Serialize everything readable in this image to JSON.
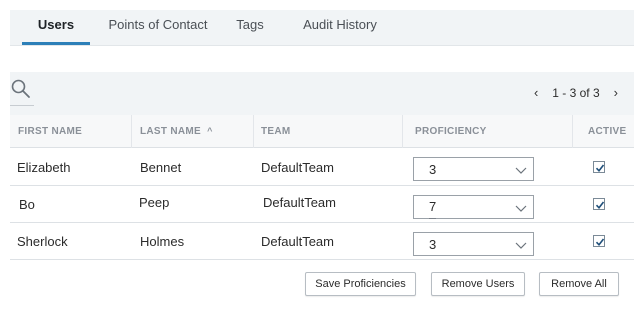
{
  "tabs": [
    {
      "label": "Users",
      "active": true
    },
    {
      "label": "Points of Contact",
      "active": false
    },
    {
      "label": "Tags",
      "active": false
    },
    {
      "label": "Audit History",
      "active": false
    }
  ],
  "toolbar": {
    "search_icon": "search-icon",
    "pager_text": "1 - 3 of 3",
    "prev_glyph": "‹",
    "next_glyph": "›"
  },
  "table": {
    "columns": [
      "FIRST NAME",
      "LAST NAME",
      "TEAM",
      "PROFICIENCY",
      "ACTIVE"
    ],
    "sort_indicator": "^",
    "rows": [
      {
        "first": "Elizabeth",
        "last": "Bennet",
        "team": "DefaultTeam",
        "proficiency": "3",
        "active": true
      },
      {
        "first": "Bo",
        "last": "Peep",
        "team": "DefaultTeam",
        "proficiency": "7",
        "active": true
      },
      {
        "first": "Sherlock",
        "last": "Holmes",
        "team": "DefaultTeam",
        "proficiency": "3",
        "active": true
      }
    ]
  },
  "actions": {
    "save_label": "Save Proficiencies",
    "remove_users_label": "Remove Users",
    "remove_all_label": "Remove All"
  },
  "colors": {
    "accent": "#2c7fb8",
    "header_bg": "#f1f4f6"
  }
}
